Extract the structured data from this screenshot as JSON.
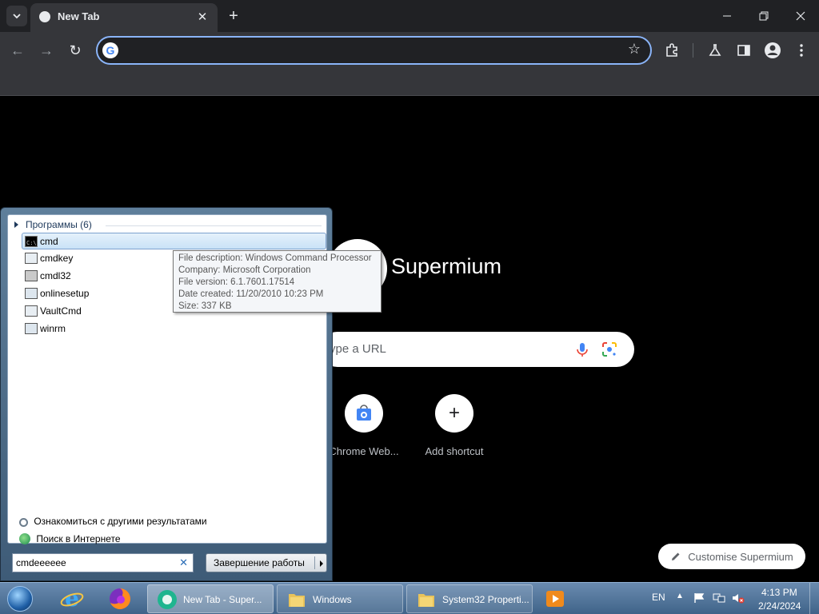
{
  "browser": {
    "tab_title": "New Tab",
    "omnibox_value": "",
    "colors": {
      "frame": "#202124",
      "toolbar": "#35363a",
      "focus_ring": "#8ab4f8"
    }
  },
  "ntp": {
    "brand": "Supermium",
    "search_placeholder": "ype a URL",
    "shortcuts": [
      {
        "label": "Chrome Web...",
        "icon": "chrome-web-store-icon"
      },
      {
        "label": "Add shortcut",
        "icon": "plus-icon"
      }
    ],
    "customise_label": "Customise Supermium"
  },
  "start_menu": {
    "group_header": "Программы (6)",
    "items": [
      {
        "label": "cmd",
        "icon": "console-icon",
        "selected": true
      },
      {
        "label": "cmdkey",
        "icon": "app-window-icon"
      },
      {
        "label": "cmdl32",
        "icon": "app-phone-icon"
      },
      {
        "label": "onlinesetup",
        "icon": "app-gear-icon"
      },
      {
        "label": "VaultCmd",
        "icon": "app-window-icon"
      },
      {
        "label": "winrm",
        "icon": "app-gear-icon"
      }
    ],
    "tooltip": [
      "File description: Windows Command Processor",
      "Company: Microsoft Corporation",
      "File version: 6.1.7601.17514",
      "Date created: 11/20/2010 10:23 PM",
      "Size: 337 KB"
    ],
    "more_results": "Ознакомиться с другими результатами",
    "search_internet": "Поиск в Интернете",
    "search_value": "cmdeeeeee",
    "shutdown_label": "Завершение работы"
  },
  "taskbar": {
    "buttons": [
      {
        "label": "New Tab - Super...",
        "icon": "supermium-icon",
        "active": true
      },
      {
        "label": "Windows",
        "icon": "folder-icon"
      },
      {
        "label": "System32 Properti...",
        "icon": "folder-icon"
      }
    ],
    "language": "EN",
    "time": "4:13 PM",
    "date": "2/24/2024"
  }
}
